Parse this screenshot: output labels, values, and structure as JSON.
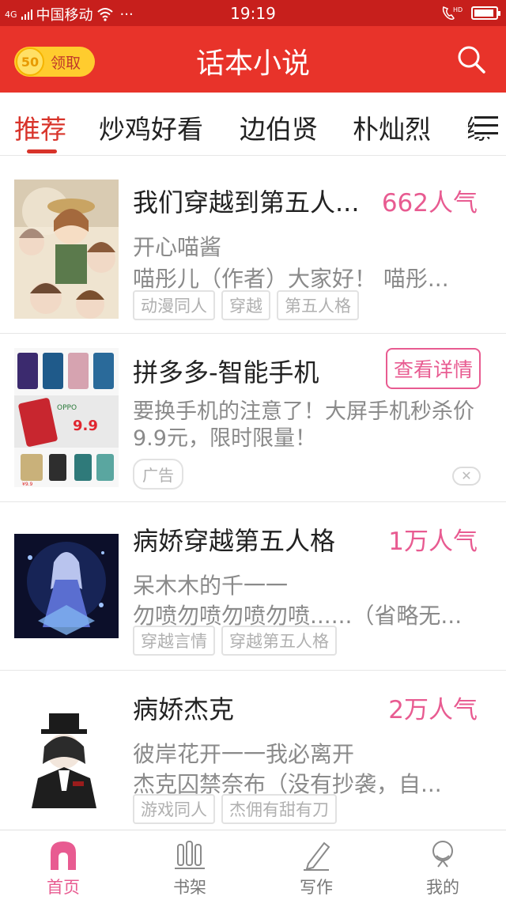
{
  "status_bar": {
    "network": "4G",
    "carrier": "中国移动",
    "more": "···",
    "time": "19:19",
    "hd": "HD"
  },
  "header": {
    "coin_value": "50",
    "claim_label": "领取",
    "title": "话本小说",
    "search_icon": "search-icon"
  },
  "tabs": [
    {
      "label": "推荐",
      "active": true
    },
    {
      "label": "炒鸡好看",
      "active": false
    },
    {
      "label": "边伯贤",
      "active": false
    },
    {
      "label": "朴灿烈",
      "active": false
    },
    {
      "label": "缘",
      "active": false
    }
  ],
  "feed": [
    {
      "type": "novel",
      "title": "我们穿越到第五人...",
      "popularity": "662人气",
      "author": "开心喵酱",
      "description": "喵彤儿（作者）大家好！ 喵彤...",
      "tags": [
        "动漫同人",
        "穿越",
        "第五人格"
      ]
    },
    {
      "type": "ad",
      "title": "拼多多-智能手机",
      "cta": "查看详情",
      "description": "要换手机的注意了！大屏手机秒杀价9.9元，限时限量！",
      "ad_label": "广告",
      "close": "✕",
      "cover_texts": {
        "brand": "OPPO",
        "price": "9.9",
        "price_small": "¥9.9"
      }
    },
    {
      "type": "novel",
      "title": "病娇穿越第五人格",
      "popularity": "1万人气",
      "author": "呆木木的千一一",
      "description": "勿喷勿喷勿喷勿喷......（省略无...",
      "tags": [
        "穿越言情",
        "穿越第五人格"
      ]
    },
    {
      "type": "novel",
      "title": "病娇杰克",
      "popularity": "2万人气",
      "author": "彼岸花开一一我必离开",
      "description": "杰克囚禁奈布（没有抄袭，自...",
      "tags": [
        "游戏同人",
        "杰佣有甜有刀"
      ]
    }
  ],
  "bottom_nav": [
    {
      "label": "首页",
      "icon": "home-icon",
      "active": true
    },
    {
      "label": "书架",
      "icon": "bookshelf-icon",
      "active": false
    },
    {
      "label": "写作",
      "icon": "pencil-icon",
      "active": false
    },
    {
      "label": "我的",
      "icon": "profile-icon",
      "active": false
    }
  ],
  "colors": {
    "brand_red": "#e8332a",
    "accent_pink": "#e85b91",
    "tab_active": "#d8332a",
    "coin_yellow": "#ffcc2e"
  }
}
